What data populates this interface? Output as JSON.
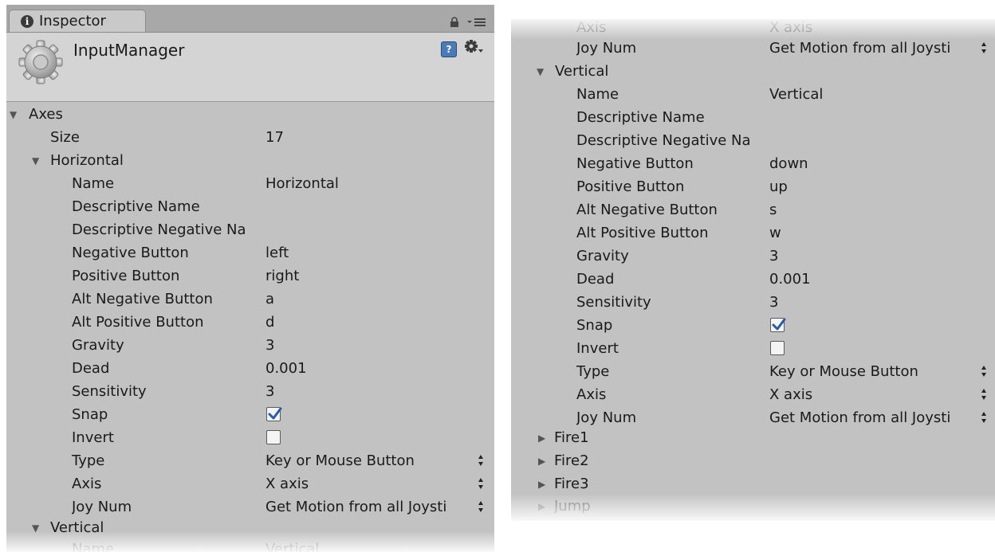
{
  "inspector": {
    "tab_label": "Inspector",
    "object_name": "InputManager"
  },
  "left": {
    "axes_label": "Axes",
    "size_label": "Size",
    "size_value": "17",
    "horizontal": {
      "title": "Horizontal",
      "name_label": "Name",
      "name_value": "Horizontal",
      "desc_name_label": "Descriptive Name",
      "desc_neg_label": "Descriptive Negative Na",
      "neg_button_label": "Negative Button",
      "neg_button_value": "left",
      "pos_button_label": "Positive Button",
      "pos_button_value": "right",
      "alt_neg_label": "Alt Negative Button",
      "alt_neg_value": "a",
      "alt_pos_label": "Alt Positive Button",
      "alt_pos_value": "d",
      "gravity_label": "Gravity",
      "gravity_value": "3",
      "dead_label": "Dead",
      "dead_value": "0.001",
      "sensitivity_label": "Sensitivity",
      "sensitivity_value": "3",
      "snap_label": "Snap",
      "snap_checked": true,
      "invert_label": "Invert",
      "invert_checked": false,
      "type_label": "Type",
      "type_value": "Key or Mouse Button",
      "axis_label": "Axis",
      "axis_value": "X axis",
      "joy_label": "Joy Num",
      "joy_value": "Get Motion from all Joysti"
    },
    "vertical_title": "Vertical",
    "vertical_name_label": "Name",
    "vertical_name_value": "Vertical"
  },
  "right": {
    "top_axis_label": "Axis",
    "top_axis_value": "X axis",
    "top_joy_label": "Joy Num",
    "top_joy_value": "Get Motion from all Joysti",
    "vertical": {
      "title": "Vertical",
      "name_label": "Name",
      "name_value": "Vertical",
      "desc_name_label": "Descriptive Name",
      "desc_neg_label": "Descriptive Negative Na",
      "neg_button_label": "Negative Button",
      "neg_button_value": "down",
      "pos_button_label": "Positive Button",
      "pos_button_value": "up",
      "alt_neg_label": "Alt Negative Button",
      "alt_neg_value": "s",
      "alt_pos_label": "Alt Positive Button",
      "alt_pos_value": "w",
      "gravity_label": "Gravity",
      "gravity_value": "3",
      "dead_label": "Dead",
      "dead_value": "0.001",
      "sensitivity_label": "Sensitivity",
      "sensitivity_value": "3",
      "snap_label": "Snap",
      "snap_checked": true,
      "invert_label": "Invert",
      "invert_checked": false,
      "type_label": "Type",
      "type_value": "Key or Mouse Button",
      "axis_label": "Axis",
      "axis_value": "X axis",
      "joy_label": "Joy Num",
      "joy_value": "Get Motion from all Joysti"
    },
    "collapsed_items": [
      "Fire1",
      "Fire2",
      "Fire3",
      "Jump"
    ]
  },
  "icons": {
    "tab": "info-icon",
    "lock": "lock-icon",
    "menu": "context-menu-icon",
    "component": "gear-icon",
    "help": "help-icon",
    "settings": "settings-gear-icon",
    "expanded": "triangle-down-icon",
    "collapsed": "triangle-right-icon",
    "spinner": "up-down-arrows-icon",
    "check": "checkmark-icon"
  },
  "colors": {
    "panel_bg": "#c2c2c2",
    "checkbox_check": "#2a5ba8"
  }
}
